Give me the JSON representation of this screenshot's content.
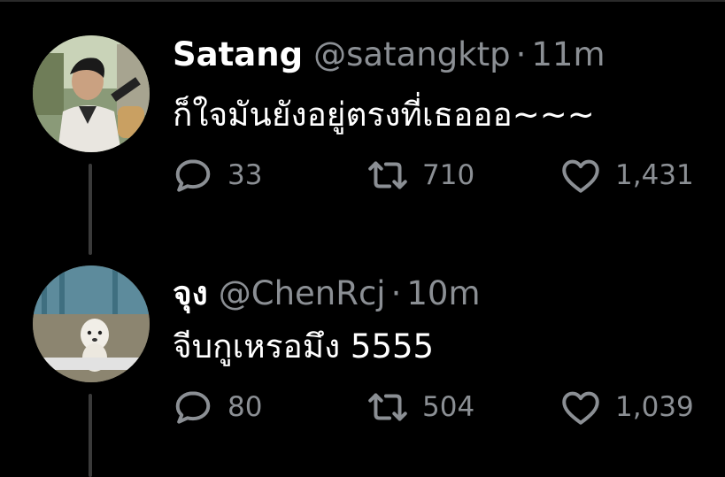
{
  "tweets": [
    {
      "display_name": "Satang",
      "handle": "@satangktp",
      "separator": "·",
      "time": "11m",
      "text": "ก็ใจมันยังอยู่ตรงที่เธอออ~~~",
      "replies": "33",
      "retweets": "710",
      "likes": "1,431"
    },
    {
      "display_name": "จุง",
      "handle": "@ChenRcj",
      "separator": "·",
      "time": "10m",
      "text": "จีบกูเหรอมึง 5555",
      "replies": "80",
      "retweets": "504",
      "likes": "1,039"
    }
  ],
  "icons": {
    "reply": "reply-icon",
    "retweet": "retweet-icon",
    "like": "like-icon"
  },
  "colors": {
    "background": "#000000",
    "text": "#ffffff",
    "muted": "#8b8f94",
    "thread_line": "#3a3a3a"
  }
}
